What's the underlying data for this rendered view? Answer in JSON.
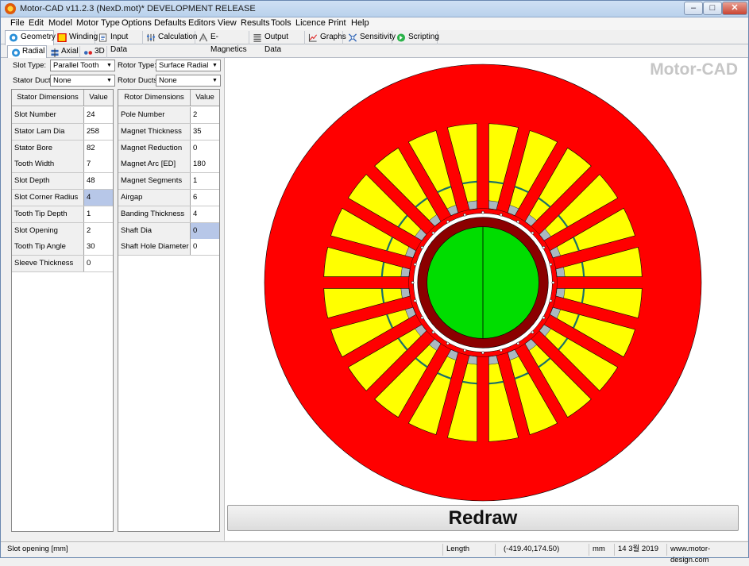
{
  "window": {
    "title": "Motor-CAD v11.2.3 (NexD.mot)* DEVELOPMENT RELEASE",
    "minimize_glyph": "–",
    "maximize_glyph": "□",
    "close_glyph": "✕"
  },
  "menu": [
    "File",
    "Edit",
    "Model",
    "Motor Type",
    "Options",
    "Defaults",
    "Editors",
    "View",
    "Results",
    "Tools",
    "Licence",
    "Print",
    "Help"
  ],
  "main_tabs": [
    {
      "label": "Geometry",
      "icon": "geometry-icon",
      "active": true
    },
    {
      "label": "Winding",
      "icon": "winding-icon"
    },
    {
      "label": "Input Data",
      "icon": "input-data-icon"
    },
    {
      "label": "Calculation",
      "icon": "calculation-icon"
    },
    {
      "label": "E-Magnetics",
      "icon": "emagnetics-icon"
    },
    {
      "label": "Output Data",
      "icon": "output-data-icon"
    },
    {
      "label": "Graphs",
      "icon": "graphs-icon"
    },
    {
      "label": "Sensitivity",
      "icon": "sensitivity-icon"
    },
    {
      "label": "Scripting",
      "icon": "scripting-icon"
    }
  ],
  "sub_tabs": [
    {
      "label": "Radial",
      "icon": "radial-icon",
      "active": true
    },
    {
      "label": "Axial",
      "icon": "axial-icon"
    },
    {
      "label": "3D",
      "icon": "3d-icon"
    }
  ],
  "selectors": {
    "slot_type_label": "Slot Type:",
    "slot_type_value": "Parallel Tooth",
    "rotor_type_label": "Rotor Type:",
    "rotor_type_value": "Surface Radial",
    "stator_ducts_label": "Stator Ducts:",
    "stator_ducts_value": "None",
    "rotor_ducts_label": "Rotor Ducts:",
    "rotor_ducts_value": "None"
  },
  "stator_table": {
    "header_name": "Stator Dimensions",
    "header_value": "Value",
    "rows": [
      {
        "name": "Slot Number",
        "value": "24"
      },
      {
        "name": "Stator Lam Dia",
        "value": "258"
      },
      {
        "name": "Stator Bore",
        "value": "82"
      },
      {
        "name": "Tooth Width",
        "value": "7"
      },
      {
        "name": "Slot Depth",
        "value": "48"
      },
      {
        "name": "Slot Corner Radius",
        "value": "4",
        "selected": true
      },
      {
        "name": "Tooth Tip Depth",
        "value": "1"
      },
      {
        "name": "Slot Opening",
        "value": "2"
      },
      {
        "name": "Tooth Tip Angle",
        "value": "30"
      },
      {
        "name": "Sleeve Thickness",
        "value": "0"
      }
    ]
  },
  "rotor_table": {
    "header_name": "Rotor Dimensions",
    "header_value": "Value",
    "rows": [
      {
        "name": "Pole Number",
        "value": "2"
      },
      {
        "name": "Magnet Thickness",
        "value": "35"
      },
      {
        "name": "Magnet Reduction",
        "value": "0"
      },
      {
        "name": "Magnet Arc [ED]",
        "value": "180"
      },
      {
        "name": "Magnet Segments",
        "value": "1"
      },
      {
        "name": "Airgap",
        "value": "6"
      },
      {
        "name": "Banding Thickness",
        "value": "4"
      },
      {
        "name": "Shaft Dia",
        "value": "0",
        "selected": true
      },
      {
        "name": "Shaft Hole Diameter",
        "value": "0"
      }
    ]
  },
  "drawing": {
    "brand": "Motor-CAD",
    "redraw_label": "Redraw",
    "colors": {
      "stator": "#ff0000",
      "winding": "#ffff00",
      "slot_liner": "#aab8c0",
      "wedge": "#1a6f6a",
      "banding": "#8b0000",
      "magnet": "#00dd00",
      "outline": "#000000"
    }
  },
  "status": {
    "hint": "Slot opening [mm]",
    "measure_label": "Length",
    "coordinates": "(-419.40,174.50)",
    "unit": "mm",
    "date": "14 3월 2019",
    "website": "www.motor-design.com"
  }
}
